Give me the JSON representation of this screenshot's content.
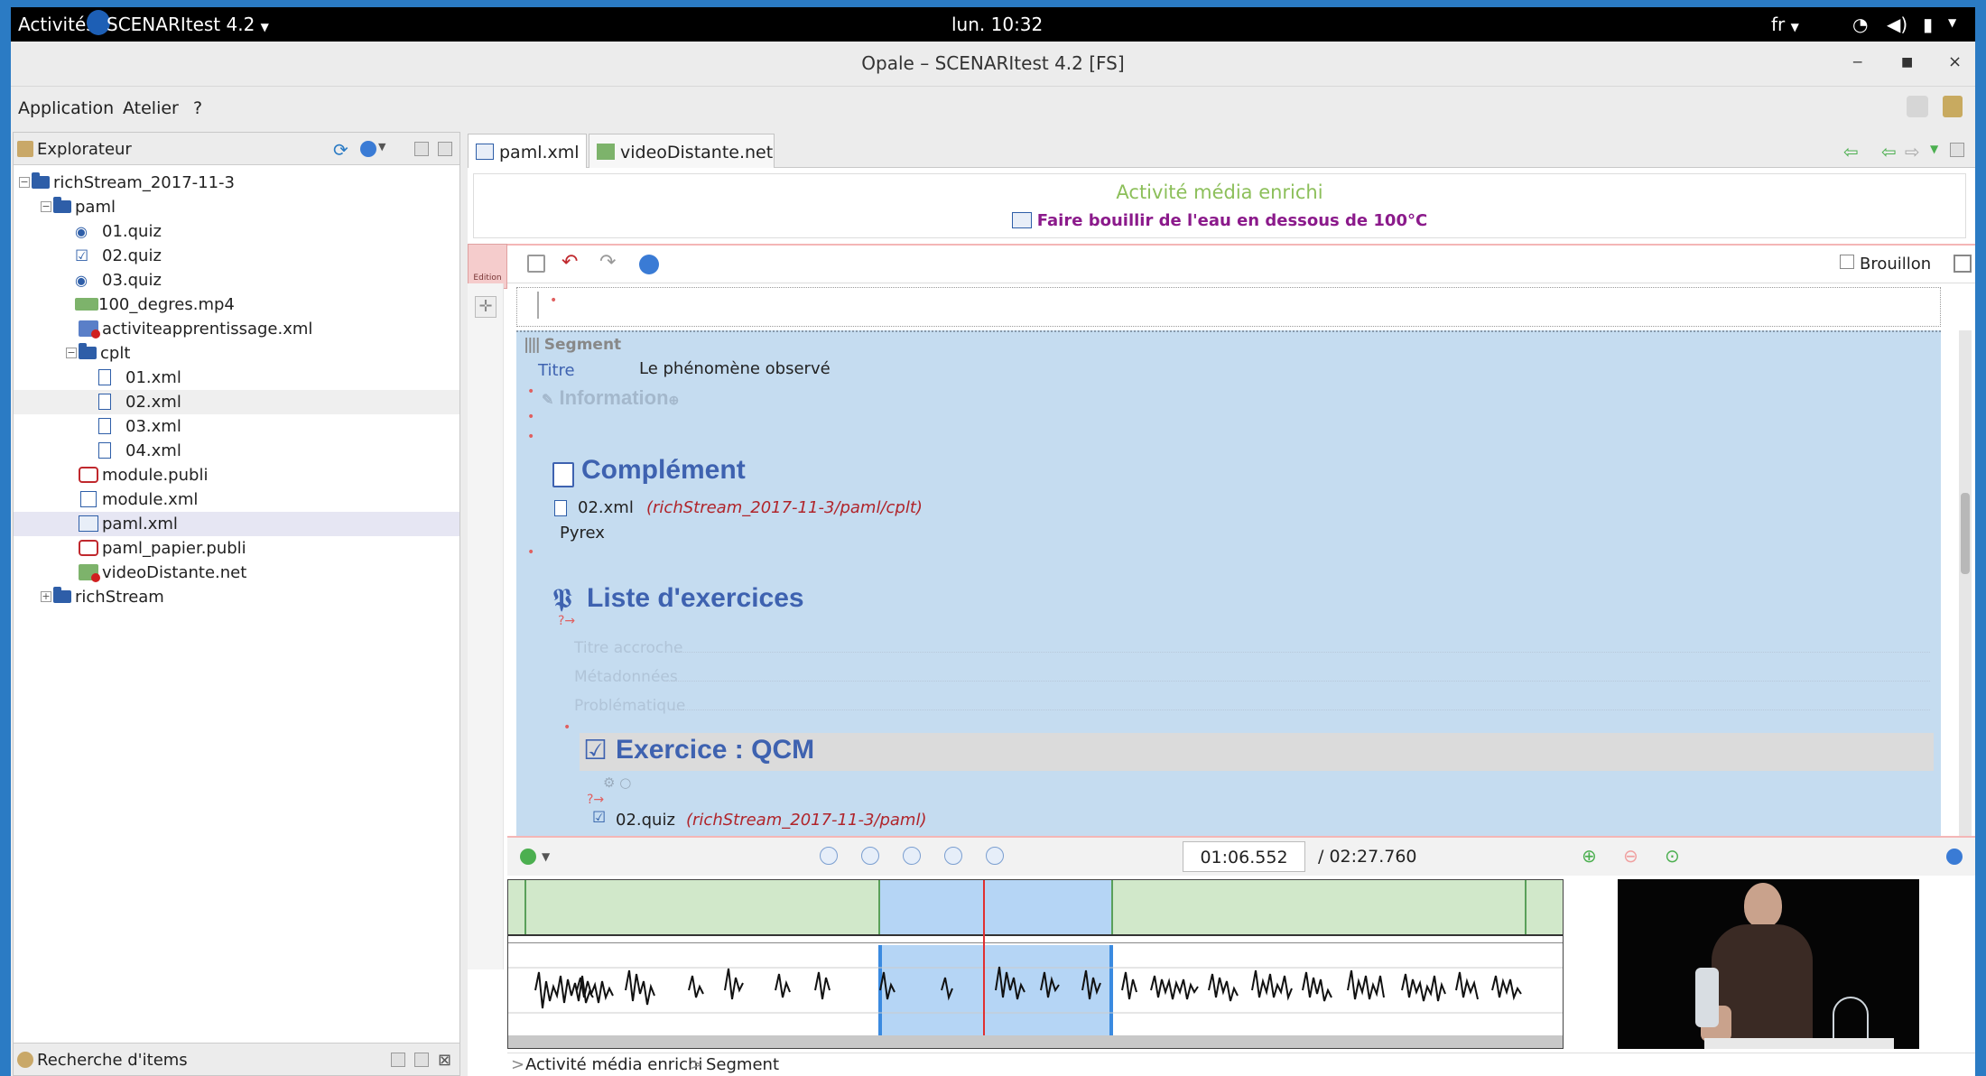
{
  "topbar": {
    "activities": "Activités",
    "app_name": "SCENARItest 4.2",
    "clock": "lun. 10:32",
    "lang": "fr"
  },
  "window": {
    "title": "Opale – SCENARItest 4.2 [FS]"
  },
  "menubar": {
    "items": [
      "Application",
      "Atelier",
      "?"
    ]
  },
  "explorer": {
    "title": "Explorateur",
    "tree": [
      {
        "label": "richStream_2017-11-3",
        "icon": "folder-icon",
        "level": 0
      },
      {
        "label": "paml",
        "icon": "folder-icon",
        "level": 1
      },
      {
        "label": "01.quiz",
        "icon": "radio-icon",
        "level": 2
      },
      {
        "label": "02.quiz",
        "icon": "checkbox-icon",
        "level": 2
      },
      {
        "label": "03.quiz",
        "icon": "radio-icon",
        "level": 2
      },
      {
        "label": "100_degres.mp4",
        "icon": "video-icon",
        "level": 2
      },
      {
        "label": "activiteapprentissage.xml",
        "icon": "activity-icon",
        "level": 2
      },
      {
        "label": "cplt",
        "icon": "folder-icon",
        "level": 2
      },
      {
        "label": "01.xml",
        "icon": "page-icon",
        "level": 3
      },
      {
        "label": "02.xml",
        "icon": "page-icon",
        "level": 3
      },
      {
        "label": "03.xml",
        "icon": "page-icon",
        "level": 3
      },
      {
        "label": "04.xml",
        "icon": "page-icon",
        "level": 3
      },
      {
        "label": "module.publi",
        "icon": "publi-icon",
        "level": 2
      },
      {
        "label": "module.xml",
        "icon": "module-icon",
        "level": 2
      },
      {
        "label": "paml.xml",
        "icon": "media-icon",
        "level": 2
      },
      {
        "label": "paml_papier.publi",
        "icon": "publi-icon",
        "level": 2
      },
      {
        "label": "videoDistante.net",
        "icon": "remote-video-icon",
        "level": 2
      },
      {
        "label": "richStream",
        "icon": "folder-icon",
        "level": 1
      }
    ],
    "search_title": "Recherche d'items"
  },
  "tabs": [
    {
      "label": "paml.xml",
      "icon": "media-icon",
      "active": true
    },
    {
      "label": "videoDistante.net",
      "icon": "remote-video-icon",
      "active": false
    }
  ],
  "document": {
    "type_label": "Activité média enrichi",
    "title": "Faire bouillir de l'eau en dessous de 100°C",
    "edition_label": "Edition",
    "draft_label": "Brouillon"
  },
  "segment": {
    "header": "Segment",
    "titre_label": "Titre",
    "titre_value": "Le phénomène observé",
    "information_label": "Information",
    "complement_heading": "Complément",
    "complement_ref_file": "02.xml",
    "complement_ref_path": "(richStream_2017-11-3/paml/cplt)",
    "complement_caption": "Pyrex",
    "exercises_heading": "Liste d'exercices",
    "field_titre_accroche": "Titre accroche",
    "field_metadonnees": "Métadonnées",
    "field_problematique": "Problématique",
    "exercise_heading": "Exercice : QCM",
    "exercise_ref_file": "02.quiz",
    "exercise_ref_path": "(richStream_2017-11-3/paml)"
  },
  "timeline": {
    "current_time": "01:06.552",
    "separator": "/",
    "total_time": "02:27.760"
  },
  "breadcrumb": {
    "items": [
      "Activité média enrichi",
      "Segment"
    ],
    "separator": ">"
  },
  "colors": {
    "accent_blue": "#2b7bc4",
    "segment_bg": "#c5dcf0",
    "heading_blue": "#3e62b0",
    "ref_red": "#b0242a",
    "type_green": "#8cbf5a",
    "title_purple": "#8b1a8b"
  }
}
